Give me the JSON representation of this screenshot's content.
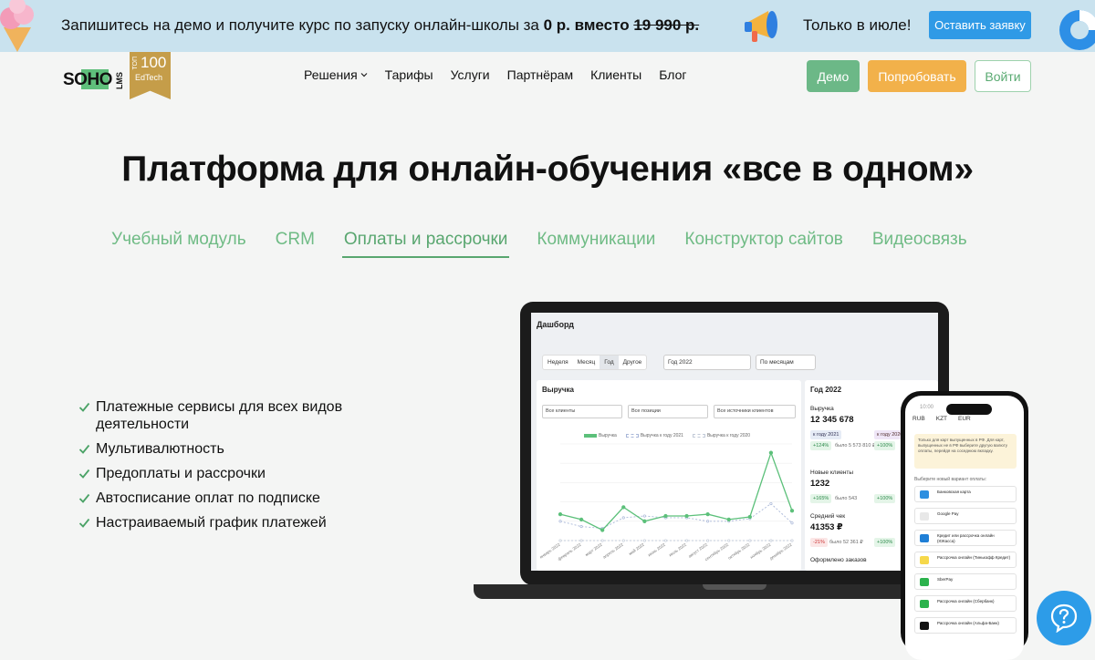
{
  "promo": {
    "text_before": "Запишитесь на демо и получите курс по запуску онлайн-школы за ",
    "price_new": "0 р. вместо",
    "price_old": "19 990 р.",
    "july": "Только в июле!",
    "apply_button": "Оставить заявку"
  },
  "logo": {
    "name": "SOHO",
    "suffix": "LMS",
    "badge_top": "ТОП",
    "badge_num": "100",
    "badge_sub": "EdTech"
  },
  "nav": {
    "items": [
      "Решения",
      "Тарифы",
      "Услуги",
      "Партнёрам",
      "Клиенты",
      "Блог"
    ]
  },
  "header_buttons": {
    "demo": "Демо",
    "try": "Попробовать",
    "login": "Войти"
  },
  "hero": {
    "title": "Платформа для онлайн-обучения «все в одном»"
  },
  "tabs": [
    {
      "label": "Учебный модуль",
      "active": false
    },
    {
      "label": "CRM",
      "active": false
    },
    {
      "label": "Оплаты и рассрочки",
      "active": true
    },
    {
      "label": "Коммуникации",
      "active": false
    },
    {
      "label": "Конструктор сайтов",
      "active": false
    },
    {
      "label": "Видеосвязь",
      "active": false
    }
  ],
  "features": [
    "Платежные сервисы для всех видов деятельности",
    "Мультивалютность",
    "Предоплаты и рассрочки",
    "Автосписание оплат по подписке",
    "Настраиваемый график платежей"
  ],
  "dashboard": {
    "title": "Дашборд",
    "periods": [
      "Неделя",
      "Месяц",
      "Год",
      "Другое"
    ],
    "active_period": "Год",
    "year_select": "Год 2022",
    "group_select": "По месяцам",
    "revenue_title": "Выручка",
    "filters": [
      "Все клиенты",
      "Все позиции",
      "Все источники клиентов"
    ],
    "legend": [
      "Выручка",
      "Выручка к году 2021",
      "Выручка к году 2020"
    ],
    "stats_title": "Год 2022",
    "stats": [
      {
        "label": "Выручка",
        "value": "12 345 678",
        "chip1": "к году 2021",
        "chip2": "+124%",
        "chip3": "было 5 573 810 ₽",
        "chip4": "к году 2020",
        "chip5": "+100%"
      },
      {
        "label": "Новые клиенты",
        "value": "1232",
        "chip2": "+165%",
        "chip3": "было 543",
        "chip5": "+100%"
      },
      {
        "label": "Средний чек",
        "value": "41353 ₽",
        "chip2": "-21%",
        "chip3": "было 52 361 ₽",
        "chip5": "+100%"
      },
      {
        "label": "Оформлено заказов",
        "value": ""
      }
    ]
  },
  "chart_data": {
    "type": "line",
    "categories": [
      "январь 2022",
      "февраль 2022",
      "март 2022",
      "апрель 2022",
      "май 2022",
      "июнь 2022",
      "июль 2022",
      "август 2022",
      "сентябрь 2022",
      "октябрь 2022",
      "ноябрь 2022",
      "декабрь 2022"
    ],
    "series": [
      {
        "name": "Выручка",
        "values": [
          30,
          24,
          12,
          38,
          22,
          28,
          28,
          30,
          24,
          27,
          100,
          34
        ]
      },
      {
        "name": "Выручка к году 2021",
        "values": [
          22,
          16,
          14,
          26,
          28,
          26,
          26,
          22,
          22,
          25,
          42,
          20
        ]
      },
      {
        "name": "Выручка к году 2020",
        "values": [
          0,
          0,
          0,
          0,
          0,
          0,
          0,
          0,
          0,
          0,
          0,
          0
        ]
      }
    ],
    "ylim": [
      0,
      110
    ],
    "colors": [
      "#5cc07a",
      "#a9b7d8",
      "#c3cbd8"
    ]
  },
  "phone": {
    "time": "10:00",
    "currencies": [
      "RUB",
      "KZT",
      "EUR"
    ],
    "note": "Только для карт выпущенных в РФ. Для карт, выпущенных не в РФ выберите другую валюту оплаты, перейдя на соседнюю вкладку.",
    "pay_head": "Выберите новый вариант оплаты:",
    "methods": [
      {
        "label": "Банковская карта",
        "color": "#2d8fe0"
      },
      {
        "label": "Google Pay",
        "color": "#e8e8e8"
      },
      {
        "label": "Кредит или рассрочка онлайн (ЮКасса)",
        "color": "#1f7fd6"
      },
      {
        "label": "Рассрочка онлайн (Тинькофф Кредит)",
        "color": "#f6d84a"
      },
      {
        "label": "SberPay",
        "color": "#2bb24c"
      },
      {
        "label": "Рассрочка онлайн (Сбербанк)",
        "color": "#2bb24c"
      },
      {
        "label": "Рассрочка онлайн (Альфа-Банк)",
        "color": "#111111"
      }
    ]
  }
}
